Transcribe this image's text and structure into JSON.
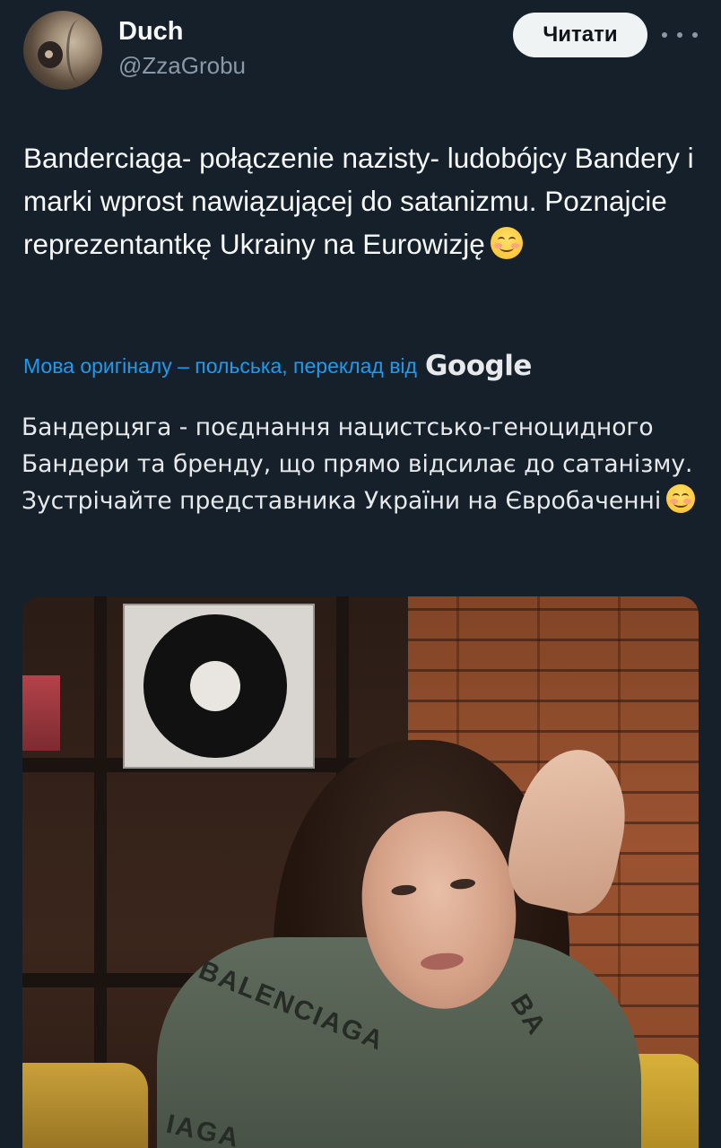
{
  "author": {
    "display_name": "Duch",
    "handle": "@ZzaGrobu"
  },
  "header": {
    "follow_label": "Читати",
    "more_icon": "more-horizontal-icon"
  },
  "tweet": {
    "text": "Banderciaga- połączenie nazisty- ludobójcy Bandery i marki wprost nawiązującej do satanizmu. Poznajcie reprezentantkę Ukrainy na Eurowizję",
    "emoji": "smiling-face-with-smiling-eyes"
  },
  "translation": {
    "label": "Мова оригіналу – польська, переклад від",
    "provider": "Google",
    "text": "Бандерцяга - поєднання нацистсько-геноцидного Бандери та бренду, що прямо відсилає до сатанізму. Зустрічайте представника України на Євробаченні"
  },
  "media": {
    "kind": "photo",
    "sweater_text_1": "BALENCIAGA",
    "sweater_text_2": "BA",
    "sweater_text_3": "IAGA"
  },
  "colors": {
    "background": "#15202b",
    "link": "#1d9bf0",
    "secondary_text": "#8b98a5",
    "button_bg": "#eff3f4"
  }
}
